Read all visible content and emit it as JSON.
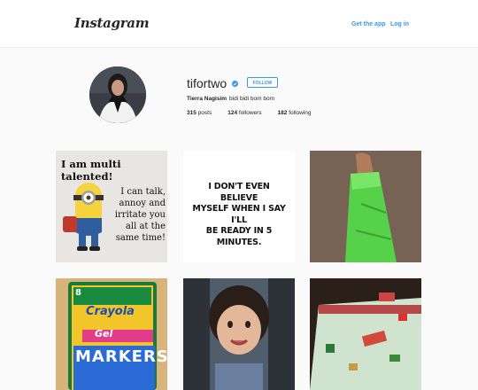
{
  "header": {
    "logo": "Instagram",
    "get_app": "Get the app",
    "log_in": "Log in"
  },
  "profile": {
    "username": "tifortwo",
    "follow_label": "FOLLOW",
    "full_name": "Tierra Nagisim",
    "bio": "bidi bidi bom bom",
    "stats": {
      "posts_count": "315",
      "posts_label": "posts",
      "followers_count": "124",
      "followers_label": "followers",
      "following_count": "182",
      "following_label": "following"
    }
  },
  "posts": {
    "p1": {
      "line1": "I am multi talented!",
      "line2": "I can talk,",
      "line3": "annoy and",
      "line4": "irritate you",
      "line5": "all at the",
      "line6": "same time!"
    },
    "p2": {
      "line1": "I DON'T EVEN BELIEVE",
      "line2": "MYSELF WHEN I SAY I'LL",
      "line3": "BE READY IN 5 MINUTES."
    },
    "p4": {
      "brand": "Crayola",
      "gel": "Gel",
      "markers": "MARKERS",
      "count": "8"
    }
  },
  "colors": {
    "link_blue": "#3897f0",
    "text": "#262626",
    "background": "#fafafa"
  }
}
